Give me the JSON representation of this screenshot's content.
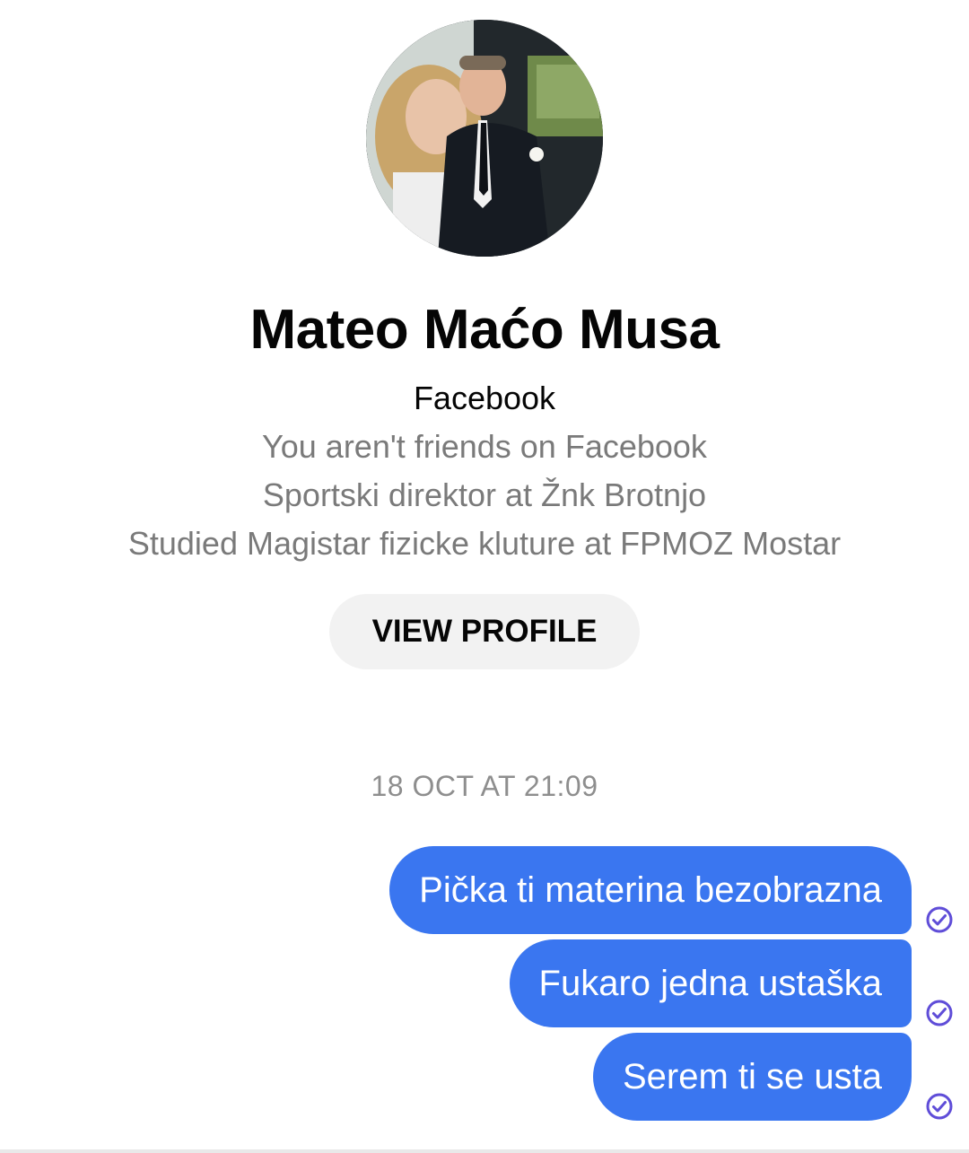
{
  "contact": {
    "avatar_icon": "profile-photo",
    "name": "Mateo Maćo Musa",
    "platform": "Facebook",
    "info": [
      "You aren't friends on Facebook",
      "Sportski direktor at Žnk Brotnjo",
      "Studied Magistar fizicke kluture at FPMOZ Mostar"
    ],
    "view_profile_label": "VIEW PROFILE"
  },
  "conversation": {
    "timestamp": "18 OCT AT 21:09",
    "messages": [
      {
        "text": "Pička ti materina bezobrazna",
        "status_icon": "delivered-check-icon"
      },
      {
        "text": "Fukaro jedna ustaška",
        "status_icon": "delivered-check-icon"
      },
      {
        "text": "Serem ti se usta",
        "status_icon": "delivered-check-icon"
      }
    ]
  },
  "colors": {
    "bubble": "#3a76f0",
    "check": "#5f4dd8",
    "secondary_text": "#7a7a7a"
  }
}
